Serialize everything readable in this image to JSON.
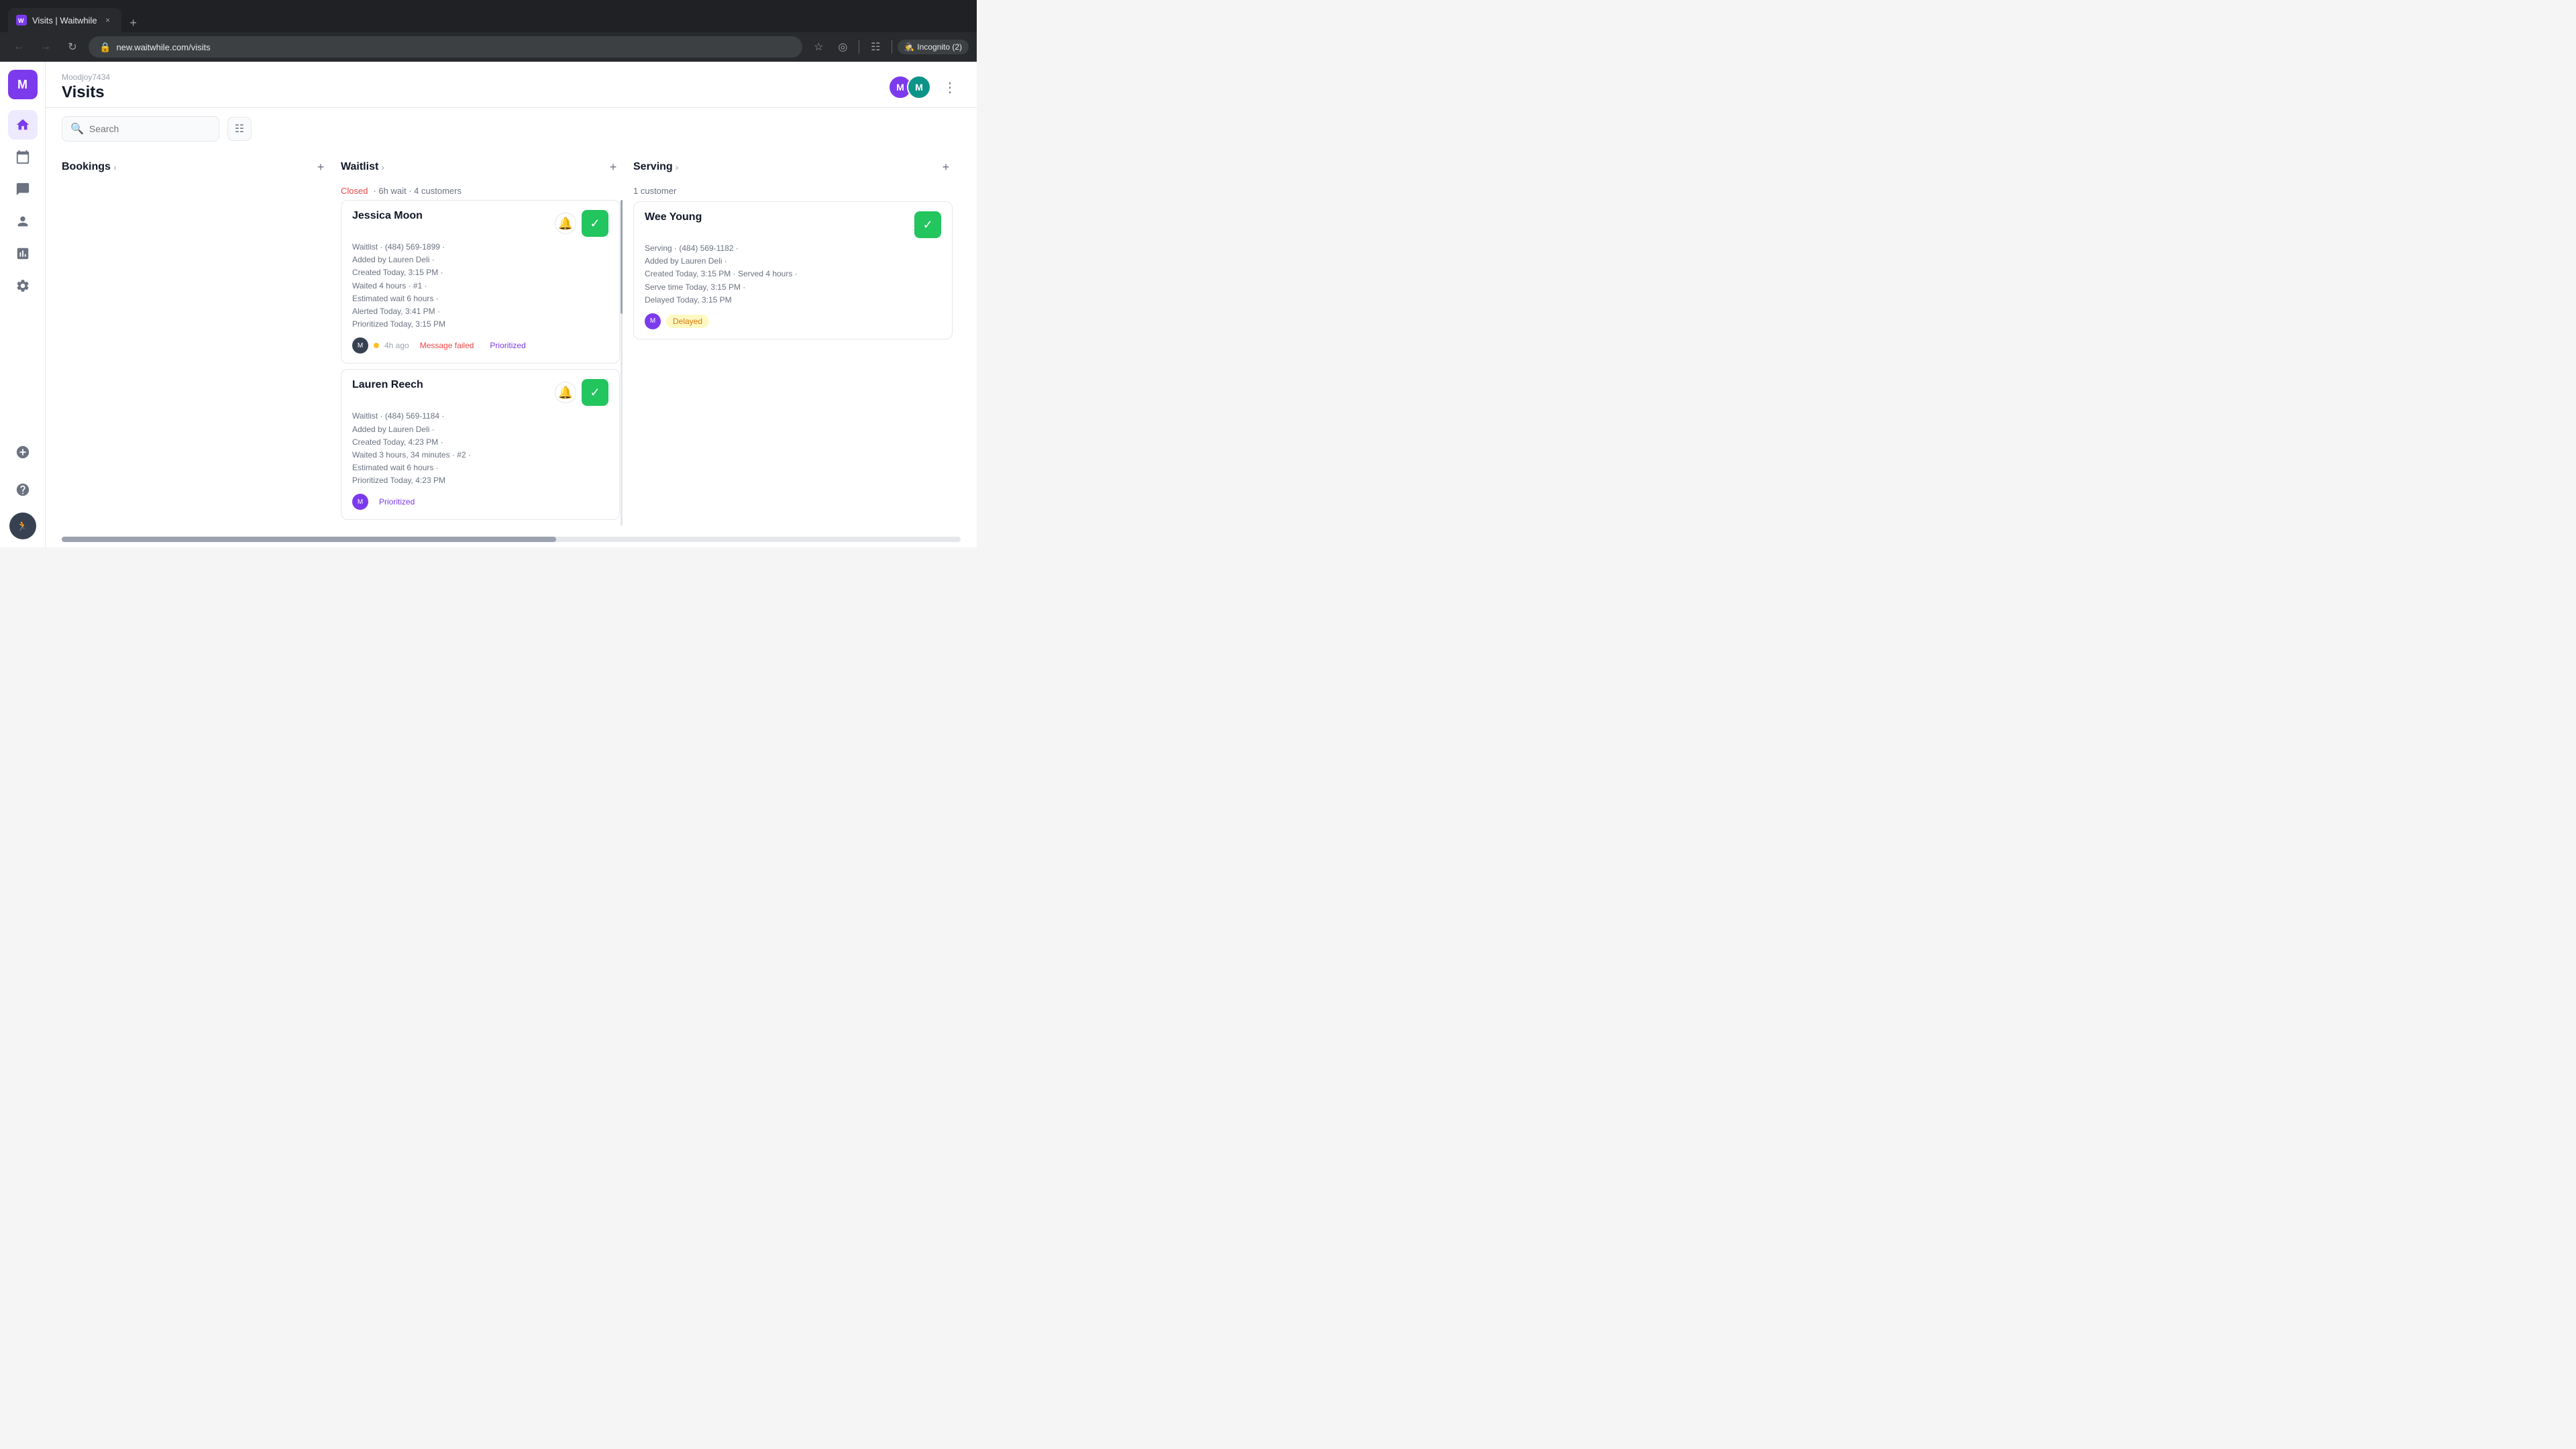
{
  "browser": {
    "tab_favicon": "M",
    "tab_title": "Visits | Waitwhile",
    "tab_close": "×",
    "new_tab": "+",
    "address": "new.waitwhile.com/visits",
    "incognito_label": "Incognito (2)"
  },
  "sidebar": {
    "logo_letter": "M",
    "account_name": "Moodjoy7434"
  },
  "header": {
    "breadcrumb": "Moodjoy7434",
    "title": "Visits",
    "avatar1_letter": "M",
    "avatar2_letter": "M"
  },
  "toolbar": {
    "search_placeholder": "Search",
    "filter_icon": "≡"
  },
  "bookings": {
    "title": "Bookings",
    "add_icon": "+"
  },
  "waitlist": {
    "title": "Waitlist",
    "add_icon": "+",
    "status_label": "Closed",
    "status_info": "· 6h wait · 4 customers",
    "customers": [
      {
        "name": "Jessica Moon",
        "detail_line1": "Waitlist · (484) 569-1899 ·",
        "detail_line2": "Added by Lauren Deli ·",
        "detail_line3": "Created Today, 3:15 PM ·",
        "detail_line4": "Waited 4 hours · #1 ·",
        "detail_line5": "Estimated wait 6 hours ·",
        "detail_line6": "Alerted Today, 3:41 PM ·",
        "detail_line7": "Prioritized Today, 3:15 PM",
        "time_ago": "4h ago",
        "badge1_label": "Message failed",
        "badge2_label": "Prioritized"
      },
      {
        "name": "Lauren Reech",
        "detail_line1": "Waitlist · (484) 569-1184 ·",
        "detail_line2": "Added by Lauren Deli ·",
        "detail_line3": "Created Today, 4:23 PM ·",
        "detail_line4": "Waited 3 hours, 34 minutes · #2 ·",
        "detail_line5": "Estimated wait 6 hours ·",
        "detail_line6": "Prioritized Today, 4:23 PM",
        "time_ago": "",
        "badge1_label": "Prioritized",
        "badge2_label": ""
      }
    ]
  },
  "serving": {
    "title": "Serving",
    "add_icon": "+",
    "customer_count": "1 customer",
    "customers": [
      {
        "name": "Wee Young",
        "detail_line1": "Serving · (484) 569-1182 ·",
        "detail_line2": "Added by Lauren Deli ·",
        "detail_line3": "Created Today, 3:15 PM · Served 4 hours ·",
        "detail_line4": "Serve time Today, 3:15 PM ·",
        "detail_line5": "Delayed Today, 3:15 PM",
        "status_label": "Delayed"
      }
    ]
  }
}
